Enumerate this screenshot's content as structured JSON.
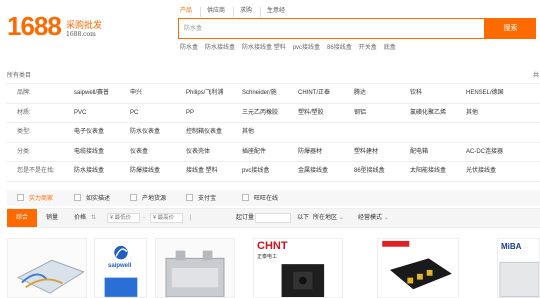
{
  "header": {
    "logo_number": "1688",
    "logo_chinese": "采购批发",
    "logo_url": "1688.com",
    "search_tabs": [
      "产品",
      "供应商",
      "求购",
      "生意经"
    ],
    "search_placeholder": "防水盒",
    "search_button": "搜索",
    "hot_words": [
      "防水盒",
      "防水接线盒",
      "防水接线盒 塑料",
      "pvc接线盒",
      "86接线盒",
      "开关盒",
      "底盒"
    ]
  },
  "breadcrumb": {
    "left": "所有类目",
    "right": "共"
  },
  "filters": [
    {
      "label": "品牌:",
      "items": [
        "saipwell/赛普",
        "申兴",
        "Philips/飞利浦",
        "Schneider/施",
        "CHINT/正泰",
        "腾达",
        "钦科",
        "HENSEL/德国"
      ]
    },
    {
      "label": "材质:",
      "items": [
        "PVC",
        "PC",
        "PP",
        "三元乙丙橡胶",
        "塑料/塑胶",
        "钢铝",
        "氯磺化聚乙烯",
        "其他"
      ]
    },
    {
      "label": "类型:",
      "items": [
        "电子仪表盒",
        "防水仪表盒",
        "控制箱仪表盒",
        "其他"
      ]
    },
    {
      "label": "分类:",
      "items": [
        "电缆接线盒",
        "仪表盒",
        "仪表壳体",
        "插座配件",
        "防爆器材",
        "塑料建材",
        "配电箱",
        "AC-DC连接器"
      ]
    },
    {
      "label": "您是不是在找:",
      "items": [
        "防水接线盒",
        "防爆接线盒",
        "接线盒 塑料",
        "pvc接线盒",
        "金属接线盒",
        "86型接线盒",
        "太阳能接线盒",
        "光伏接线盒"
      ]
    }
  ],
  "checks": [
    "实力商家",
    "如实描述",
    "产地货源",
    "支付宝",
    "旺旺在线"
  ],
  "sortbar": {
    "active": "综合",
    "sales": "销量",
    "price": "价格",
    "price_min_placeholder": "¥ 最低价",
    "price_max_placeholder": "¥ 最高价",
    "moq": "起订量",
    "below": "以下",
    "region": "所在地区",
    "mode": "经营模式"
  },
  "cards": [
    {
      "brand": ""
    },
    {
      "brand": "saipwell"
    },
    {
      "brand": ""
    },
    {
      "brand": "CHNT",
      "brand_sub": "正泰电工"
    },
    {
      "brand": ""
    },
    {
      "brand": "MiBA"
    }
  ],
  "colors": {
    "accent": "#ff6a00"
  }
}
